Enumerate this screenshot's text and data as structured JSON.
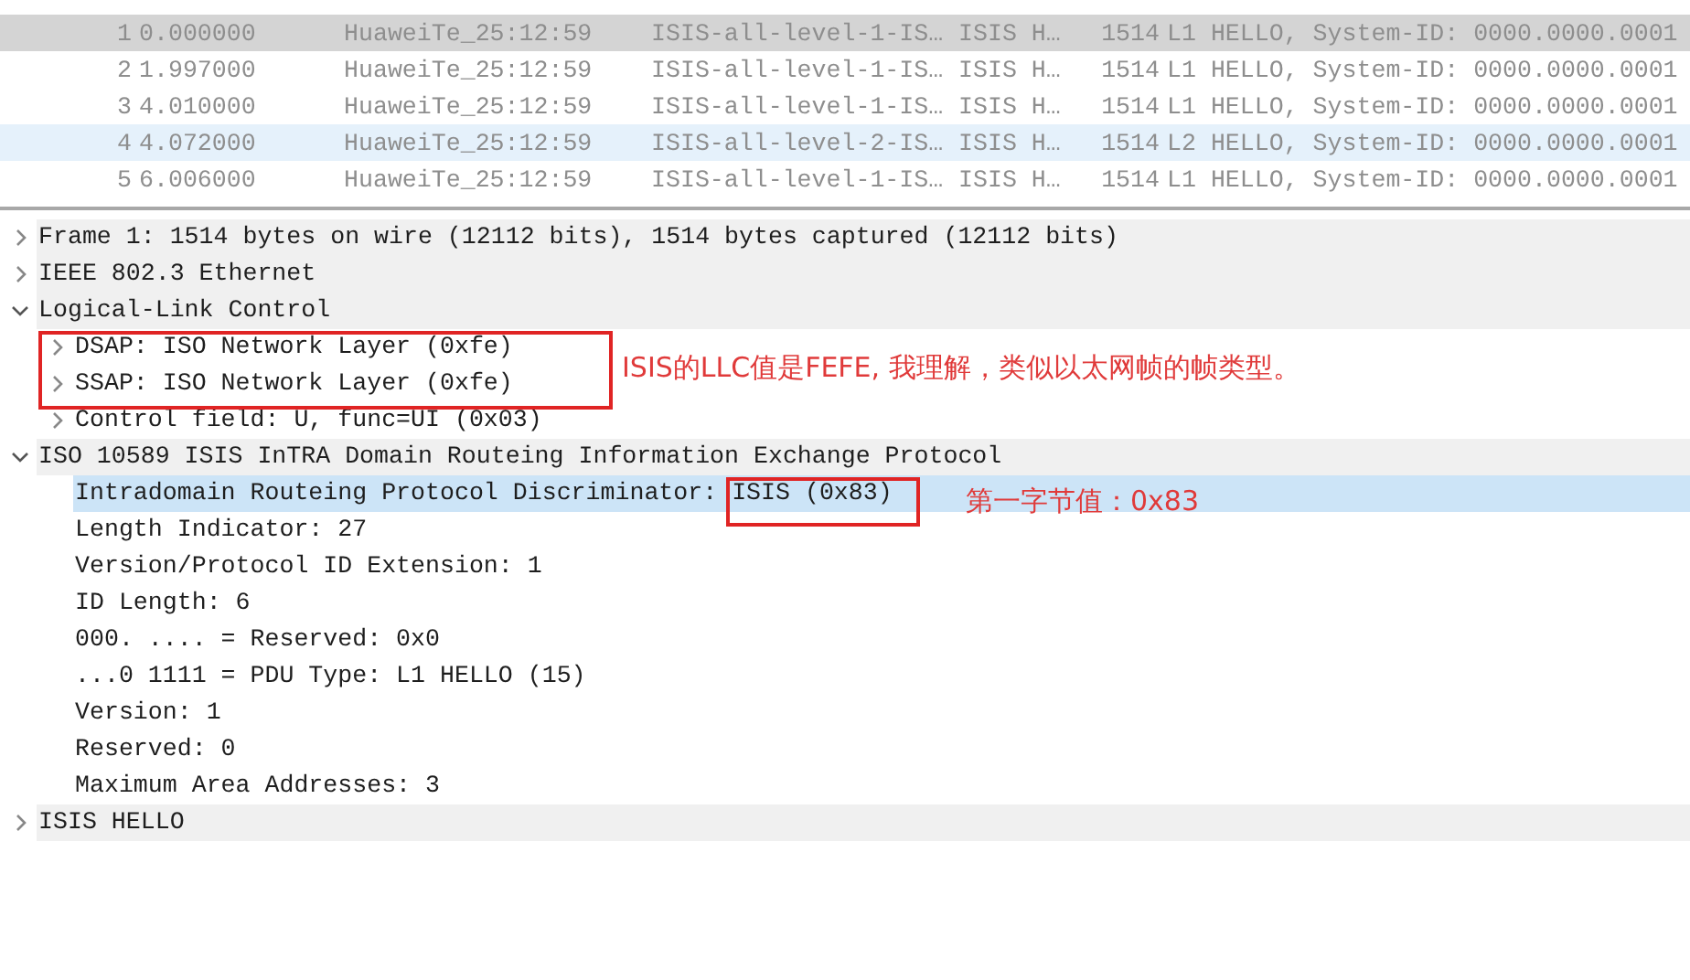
{
  "packet_list": {
    "rows": [
      {
        "no": "1",
        "time": "0.000000",
        "source": "HuaweiTe_25:12:59",
        "destination": "ISIS-all-level-1-IS…",
        "protocol": "ISIS H…",
        "length": "1514",
        "info": "L1 HELLO, System-ID: 0000.0000.0001",
        "selected": true
      },
      {
        "no": "2",
        "time": "1.997000",
        "source": "HuaweiTe_25:12:59",
        "destination": "ISIS-all-level-1-IS…",
        "protocol": "ISIS H…",
        "length": "1514",
        "info": "L1 HELLO, System-ID: 0000.0000.0001",
        "selected": false,
        "color": "#ffffff"
      },
      {
        "no": "3",
        "time": "4.010000",
        "source": "HuaweiTe_25:12:59",
        "destination": "ISIS-all-level-1-IS…",
        "protocol": "ISIS H…",
        "length": "1514",
        "info": "L1 HELLO, System-ID: 0000.0000.0001",
        "selected": false,
        "color": "#ffffff"
      },
      {
        "no": "4",
        "time": "4.072000",
        "source": "HuaweiTe_25:12:59",
        "destination": "ISIS-all-level-2-IS…",
        "protocol": "ISIS H…",
        "length": "1514",
        "info": "L2 HELLO, System-ID: 0000.0000.0001",
        "selected": false,
        "color": "#e5f1fb"
      },
      {
        "no": "5",
        "time": "6.006000",
        "source": "HuaweiTe_25:12:59",
        "destination": "ISIS-all-level-1-IS…",
        "protocol": "ISIS H…",
        "length": "1514",
        "info": "L1 HELLO, System-ID: 0000.0000.0001",
        "selected": false,
        "color": "#ffffff"
      }
    ]
  },
  "packet_details": [
    {
      "label": "Frame 1: 1514 bytes on wire (12112 bits), 1514 bytes captured (12112 bits)",
      "expanded": false,
      "selected": false
    },
    {
      "label": "IEEE 802.3 Ethernet",
      "expanded": false,
      "selected": false
    },
    {
      "label": "Logical-Link Control",
      "expanded": true,
      "selected": false,
      "children": [
        {
          "label": "DSAP: ISO Network Layer (0xfe)",
          "expanded": false,
          "selected": false
        },
        {
          "label": "SSAP: ISO Network Layer (0xfe)",
          "expanded": false,
          "selected": false
        },
        {
          "label": "Control field: U, func=UI (0x03)",
          "expanded": false,
          "selected": false
        }
      ]
    },
    {
      "label": "ISO 10589 ISIS InTRA Domain Routeing Information Exchange Protocol",
      "expanded": true,
      "selected": false,
      "children": [
        {
          "label": "Intradomain Routeing Protocol Discriminator: ISIS (0x83)",
          "selected": true
        },
        {
          "label": "Length Indicator: 27",
          "selected": false
        },
        {
          "label": "Version/Protocol ID Extension: 1",
          "selected": false
        },
        {
          "label": "ID Length: 6",
          "selected": false
        },
        {
          "label": "000. .... = Reserved: 0x0",
          "selected": false
        },
        {
          "label": "...0 1111 = PDU Type: L1 HELLO (15)",
          "selected": false
        },
        {
          "label": "Version: 1",
          "selected": false
        },
        {
          "label": "Reserved: 0",
          "selected": false
        },
        {
          "label": "Maximum Area Addresses: 3",
          "selected": false
        }
      ]
    },
    {
      "label": "ISIS HELLO",
      "expanded": false,
      "selected": false
    }
  ],
  "annotations": [
    {
      "text": "ISIS的LLC值是FEFE, 我理解，类似以太网帧的帧类型。"
    },
    {
      "text": "第一字节值：0x83"
    }
  ]
}
